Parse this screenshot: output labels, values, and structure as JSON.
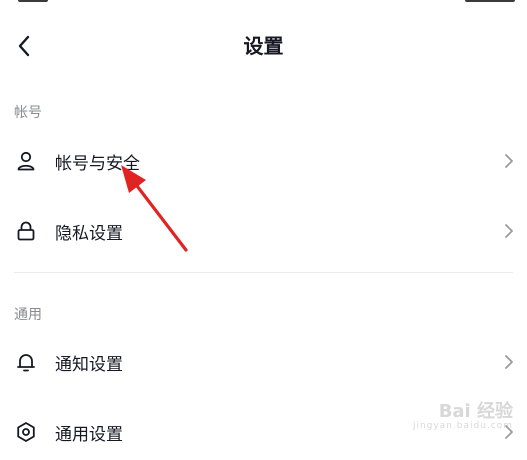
{
  "header": {
    "title": "设置",
    "back_icon": "chevron-left-icon"
  },
  "sections": [
    {
      "header": "帐号",
      "items": [
        {
          "label": "帐号与安全",
          "icon": "person-icon"
        },
        {
          "label": "隐私设置",
          "icon": "lock-icon"
        }
      ]
    },
    {
      "header": "通用",
      "items": [
        {
          "label": "通知设置",
          "icon": "bell-icon"
        },
        {
          "label": "通用设置",
          "icon": "gear-icon"
        }
      ]
    }
  ],
  "annotation": {
    "color": "#e02424",
    "target": "帐号与安全"
  },
  "watermark": {
    "brand": "Bai 经验",
    "domain": "jingyan.baidu.com"
  },
  "colors": {
    "text_primary": "#161823",
    "text_secondary": "#8a8b91",
    "chevron": "#9b9ca1",
    "divider": "#ececec"
  }
}
